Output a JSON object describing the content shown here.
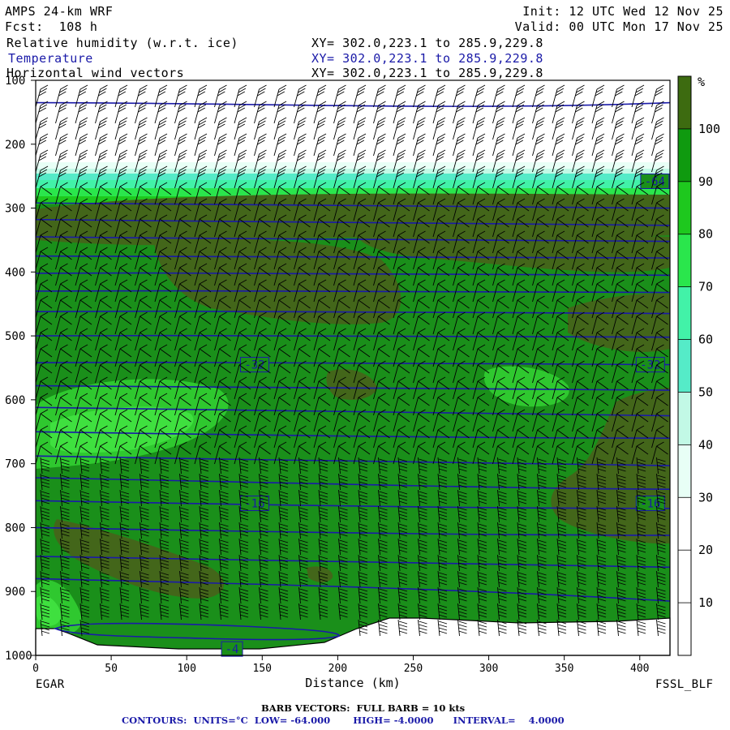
{
  "header": {
    "model": "AMPS 24-km WRF",
    "forecast": "Fcst:  108 h",
    "init": "Init: 12 UTC Wed 12 Nov 25",
    "valid": "Valid: 00 UTC Mon 17 Nov 25",
    "fields": [
      {
        "name": "Relative humidity (w.r.t. ice)",
        "xy": "XY= 302.0,223.1 to 285.9,229.8"
      },
      {
        "name": "Temperature",
        "xy": "XY= 302.0,223.1 to 285.9,229.8"
      },
      {
        "name": "Horizontal wind vectors",
        "xy": "XY= 302.0,223.1 to 285.9,229.8"
      }
    ]
  },
  "footer": {
    "barb_note": "BARB VECTORS:  FULL BARB = 10 kts",
    "contours": "CONTOURS:  UNITS=°C  LOW= -64.000       HIGH= -4.0000      INTERVAL=    4.0000",
    "left_endpoint": "EGAR",
    "right_endpoint": "FSSL_BLF"
  },
  "colors": {
    "temperature_contour": "#1a1aa8",
    "rh_scale": [
      "#ffffff",
      "#ffffff",
      "#ffffff",
      "#e8fff6",
      "#c2f9e6",
      "#55ebc8",
      "#42f2a8",
      "#2ae64c",
      "#1ec81e",
      "#0f9a0f",
      "#3d6b10"
    ]
  },
  "chart_data": {
    "type": "cross-section",
    "xlabel": "Distance (km)",
    "ylabel": "",
    "xlim": [
      0,
      420
    ],
    "ylim": [
      1000,
      100
    ],
    "x_ticks": [
      0,
      50,
      100,
      150,
      200,
      250,
      300,
      350,
      400
    ],
    "y_ticks": [
      100,
      200,
      300,
      400,
      500,
      600,
      700,
      800,
      900,
      1000
    ],
    "colorbar": {
      "unit": "%",
      "levels": [
        10,
        20,
        30,
        40,
        50,
        60,
        70,
        80,
        90,
        100
      ]
    },
    "temperature_contours": {
      "labels": [
        {
          "value": "-64",
          "x": 410,
          "p": 258
        },
        {
          "value": "-32",
          "x": 145,
          "p": 545
        },
        {
          "value": "-32",
          "x": 407,
          "p": 545
        },
        {
          "value": "-16",
          "x": 145,
          "p": 762
        },
        {
          "value": "-16",
          "x": 407,
          "p": 762
        },
        {
          "value": "-4",
          "x": 130,
          "p": 990
        }
      ]
    }
  }
}
